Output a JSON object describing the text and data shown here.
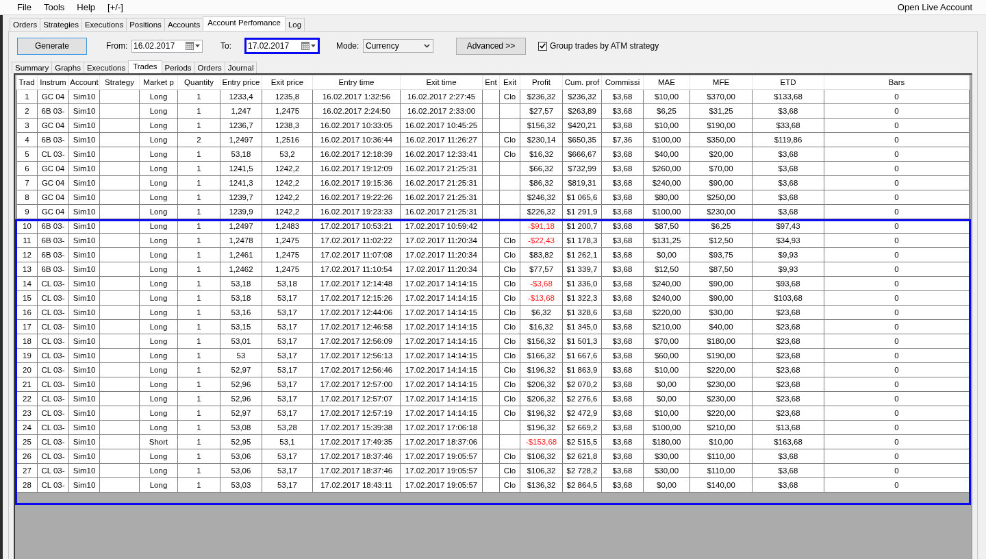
{
  "menu": {
    "items": [
      "File",
      "Tools",
      "Help",
      "[+/-]"
    ],
    "right_item": "Open Live Account"
  },
  "tabs": [
    {
      "label": "Orders",
      "selected": false
    },
    {
      "label": "Strategies",
      "selected": false
    },
    {
      "label": "Executions",
      "selected": false
    },
    {
      "label": "Positions",
      "selected": false
    },
    {
      "label": "Accounts",
      "selected": false
    },
    {
      "label": "Account Perfomance",
      "selected": true
    },
    {
      "label": "Log",
      "selected": false
    }
  ],
  "toolbar": {
    "generate_button": {
      "label": "Generate",
      "focused": true
    },
    "from": {
      "label": "From:",
      "value": "16.02.2017",
      "highlighted": false
    },
    "to": {
      "label": "To:",
      "value": "17.02.2017",
      "highlighted": true
    },
    "mode": {
      "label": "Mode:",
      "value": "Currency"
    },
    "advanced_button": "Advanced >>",
    "group_trades": {
      "label": "Group trades by ATM strategy",
      "checked": true
    }
  },
  "subtabs": [
    {
      "label": "Summary",
      "selected": false
    },
    {
      "label": "Graphs",
      "selected": false
    },
    {
      "label": "Executions",
      "selected": false
    },
    {
      "label": "Trades",
      "selected": true
    },
    {
      "label": "Periods",
      "selected": false
    },
    {
      "label": "Orders",
      "selected": false
    },
    {
      "label": "Journal",
      "selected": false
    }
  ],
  "table": {
    "columns": [
      "Trad",
      "Instrum",
      "Account",
      "Strategy",
      "Market p",
      "Quantity",
      "Entry price",
      "Exit price",
      "Entry time",
      "Exit time",
      "Ent",
      "Exit",
      "Profit",
      "Cum. prof",
      "Commissi",
      "MAE",
      "MFE",
      "ETD",
      "Bars"
    ],
    "row_groups": [
      {
        "highlighted": false,
        "rows": [
          {
            "trade": "1",
            "instrument": "GC 04",
            "account": "Sim10",
            "position": "Long",
            "quantity": "1",
            "entry_price": "1233,4",
            "exit_price": "1235,8",
            "entry_time": "16.02.2017 1:32:56",
            "exit_time": "16.02.2017 2:27:45",
            "exit": "Clo",
            "profit": "$236,32",
            "cum_profit": "$236,32",
            "commission": "$3,68",
            "mae": "$10,00",
            "mfe": "$370,00",
            "etd": "$133,68",
            "bars": "0",
            "loss": false
          },
          {
            "trade": "2",
            "instrument": "6B 03-",
            "account": "Sim10",
            "position": "Long",
            "quantity": "1",
            "entry_price": "1,247",
            "exit_price": "1,2475",
            "entry_time": "16.02.2017 2:24:50",
            "exit_time": "16.02.2017 2:33:00",
            "profit": "$27,57",
            "cum_profit": "$263,89",
            "commission": "$3,68",
            "mae": "$6,25",
            "mfe": "$31,25",
            "etd": "$3,68",
            "bars": "0",
            "loss": false
          },
          {
            "trade": "3",
            "instrument": "GC 04",
            "account": "Sim10",
            "position": "Long",
            "quantity": "1",
            "entry_price": "1236,7",
            "exit_price": "1238,3",
            "entry_time": "16.02.2017 10:33:05",
            "exit_time": "16.02.2017 10:45:25",
            "profit": "$156,32",
            "cum_profit": "$420,21",
            "commission": "$3,68",
            "mae": "$10,00",
            "mfe": "$190,00",
            "etd": "$33,68",
            "bars": "0",
            "loss": false
          },
          {
            "trade": "4",
            "instrument": "6B 03-",
            "account": "Sim10",
            "position": "Long",
            "quantity": "2",
            "entry_price": "1,2497",
            "exit_price": "1,2516",
            "entry_time": "16.02.2017 10:36:44",
            "exit_time": "16.02.2017 11:26:27",
            "exit": "Clo",
            "profit": "$230,14",
            "cum_profit": "$650,35",
            "commission": "$7,36",
            "mae": "$100,00",
            "mfe": "$350,00",
            "etd": "$119,86",
            "bars": "0",
            "loss": false
          },
          {
            "trade": "5",
            "instrument": "CL 03-",
            "account": "Sim10",
            "position": "Long",
            "quantity": "1",
            "entry_price": "53,18",
            "exit_price": "53,2",
            "entry_time": "16.02.2017 12:18:39",
            "exit_time": "16.02.2017 12:33:41",
            "exit": "Clo",
            "profit": "$16,32",
            "cum_profit": "$666,67",
            "commission": "$3,68",
            "mae": "$40,00",
            "mfe": "$20,00",
            "etd": "$3,68",
            "bars": "0",
            "loss": false
          },
          {
            "trade": "6",
            "instrument": "GC 04",
            "account": "Sim10",
            "position": "Long",
            "quantity": "1",
            "entry_price": "1241,5",
            "exit_price": "1242,2",
            "entry_time": "16.02.2017 19:12:09",
            "exit_time": "16.02.2017 21:25:31",
            "profit": "$66,32",
            "cum_profit": "$732,99",
            "commission": "$3,68",
            "mae": "$260,00",
            "mfe": "$70,00",
            "etd": "$3,68",
            "bars": "0",
            "loss": false
          },
          {
            "trade": "7",
            "instrument": "GC 04",
            "account": "Sim10",
            "position": "Long",
            "quantity": "1",
            "entry_price": "1241,3",
            "exit_price": "1242,2",
            "entry_time": "16.02.2017 19:15:36",
            "exit_time": "16.02.2017 21:25:31",
            "profit": "$86,32",
            "cum_profit": "$819,31",
            "commission": "$3,68",
            "mae": "$240,00",
            "mfe": "$90,00",
            "etd": "$3,68",
            "bars": "0",
            "loss": false
          },
          {
            "trade": "8",
            "instrument": "GC 04",
            "account": "Sim10",
            "position": "Long",
            "quantity": "1",
            "entry_price": "1239,7",
            "exit_price": "1242,2",
            "entry_time": "16.02.2017 19:22:26",
            "exit_time": "16.02.2017 21:25:31",
            "profit": "$246,32",
            "cum_profit": "$1 065,6",
            "commission": "$3,68",
            "mae": "$80,00",
            "mfe": "$250,00",
            "etd": "$3,68",
            "bars": "0",
            "loss": false
          },
          {
            "trade": "9",
            "instrument": "GC 04",
            "account": "Sim10",
            "position": "Long",
            "quantity": "1",
            "entry_price": "1239,9",
            "exit_price": "1242,2",
            "entry_time": "16.02.2017 19:23:33",
            "exit_time": "16.02.2017 21:25:31",
            "profit": "$226,32",
            "cum_profit": "$1 291,9",
            "commission": "$3,68",
            "mae": "$100,00",
            "mfe": "$230,00",
            "etd": "$3,68",
            "bars": "0",
            "loss": false
          }
        ]
      },
      {
        "highlighted": true,
        "rows": [
          {
            "trade": "10",
            "instrument": "6B 03-",
            "account": "Sim10",
            "position": "Long",
            "quantity": "1",
            "entry_price": "1,2497",
            "exit_price": "1,2483",
            "entry_time": "17.02.2017 10:53:21",
            "exit_time": "17.02.2017 10:59:42",
            "profit": "-$91,18",
            "cum_profit": "$1 200,7",
            "commission": "$3,68",
            "mae": "$87,50",
            "mfe": "$6,25",
            "etd": "$97,43",
            "bars": "0",
            "loss": true
          },
          {
            "trade": "11",
            "instrument": "6B 03-",
            "account": "Sim10",
            "position": "Long",
            "quantity": "1",
            "entry_price": "1,2478",
            "exit_price": "1,2475",
            "entry_time": "17.02.2017 11:02:22",
            "exit_time": "17.02.2017 11:20:34",
            "exit": "Clo",
            "profit": "-$22,43",
            "cum_profit": "$1 178,3",
            "commission": "$3,68",
            "mae": "$131,25",
            "mfe": "$12,50",
            "etd": "$34,93",
            "bars": "0",
            "loss": true
          },
          {
            "trade": "12",
            "instrument": "6B 03-",
            "account": "Sim10",
            "position": "Long",
            "quantity": "1",
            "entry_price": "1,2461",
            "exit_price": "1,2475",
            "entry_time": "17.02.2017 11:07:08",
            "exit_time": "17.02.2017 11:20:34",
            "exit": "Clo",
            "profit": "$83,82",
            "cum_profit": "$1 262,1",
            "commission": "$3,68",
            "mae": "$0,00",
            "mfe": "$93,75",
            "etd": "$9,93",
            "bars": "0",
            "loss": false
          },
          {
            "trade": "13",
            "instrument": "6B 03-",
            "account": "Sim10",
            "position": "Long",
            "quantity": "1",
            "entry_price": "1,2462",
            "exit_price": "1,2475",
            "entry_time": "17.02.2017 11:10:54",
            "exit_time": "17.02.2017 11:20:34",
            "exit": "Clo",
            "profit": "$77,57",
            "cum_profit": "$1 339,7",
            "commission": "$3,68",
            "mae": "$12,50",
            "mfe": "$87,50",
            "etd": "$9,93",
            "bars": "0",
            "loss": false
          },
          {
            "trade": "14",
            "instrument": "CL 03-",
            "account": "Sim10",
            "position": "Long",
            "quantity": "1",
            "entry_price": "53,18",
            "exit_price": "53,18",
            "entry_time": "17.02.2017 12:14:48",
            "exit_time": "17.02.2017 14:14:15",
            "exit": "Clo",
            "profit": "-$3,68",
            "cum_profit": "$1 336,0",
            "commission": "$3,68",
            "mae": "$240,00",
            "mfe": "$90,00",
            "etd": "$93,68",
            "bars": "0",
            "loss": true
          },
          {
            "trade": "15",
            "instrument": "CL 03-",
            "account": "Sim10",
            "position": "Long",
            "quantity": "1",
            "entry_price": "53,18",
            "exit_price": "53,17",
            "entry_time": "17.02.2017 12:15:26",
            "exit_time": "17.02.2017 14:14:15",
            "exit": "Clo",
            "profit": "-$13,68",
            "cum_profit": "$1 322,3",
            "commission": "$3,68",
            "mae": "$240,00",
            "mfe": "$90,00",
            "etd": "$103,68",
            "bars": "0",
            "loss": true
          },
          {
            "trade": "16",
            "instrument": "CL 03-",
            "account": "Sim10",
            "position": "Long",
            "quantity": "1",
            "entry_price": "53,16",
            "exit_price": "53,17",
            "entry_time": "17.02.2017 12:44:06",
            "exit_time": "17.02.2017 14:14:15",
            "exit": "Clo",
            "profit": "$6,32",
            "cum_profit": "$1 328,6",
            "commission": "$3,68",
            "mae": "$220,00",
            "mfe": "$30,00",
            "etd": "$23,68",
            "bars": "0",
            "loss": false
          },
          {
            "trade": "17",
            "instrument": "CL 03-",
            "account": "Sim10",
            "position": "Long",
            "quantity": "1",
            "entry_price": "53,15",
            "exit_price": "53,17",
            "entry_time": "17.02.2017 12:46:58",
            "exit_time": "17.02.2017 14:14:15",
            "exit": "Clo",
            "profit": "$16,32",
            "cum_profit": "$1 345,0",
            "commission": "$3,68",
            "mae": "$210,00",
            "mfe": "$40,00",
            "etd": "$23,68",
            "bars": "0",
            "loss": false
          },
          {
            "trade": "18",
            "instrument": "CL 03-",
            "account": "Sim10",
            "position": "Long",
            "quantity": "1",
            "entry_price": "53,01",
            "exit_price": "53,17",
            "entry_time": "17.02.2017 12:56:09",
            "exit_time": "17.02.2017 14:14:15",
            "exit": "Clo",
            "profit": "$156,32",
            "cum_profit": "$1 501,3",
            "commission": "$3,68",
            "mae": "$70,00",
            "mfe": "$180,00",
            "etd": "$23,68",
            "bars": "0",
            "loss": false
          },
          {
            "trade": "19",
            "instrument": "CL 03-",
            "account": "Sim10",
            "position": "Long",
            "quantity": "1",
            "entry_price": "53",
            "exit_price": "53,17",
            "entry_time": "17.02.2017 12:56:13",
            "exit_time": "17.02.2017 14:14:15",
            "exit": "Clo",
            "profit": "$166,32",
            "cum_profit": "$1 667,6",
            "commission": "$3,68",
            "mae": "$60,00",
            "mfe": "$190,00",
            "etd": "$23,68",
            "bars": "0",
            "loss": false
          },
          {
            "trade": "20",
            "instrument": "CL 03-",
            "account": "Sim10",
            "position": "Long",
            "quantity": "1",
            "entry_price": "52,97",
            "exit_price": "53,17",
            "entry_time": "17.02.2017 12:56:46",
            "exit_time": "17.02.2017 14:14:15",
            "exit": "Clo",
            "profit": "$196,32",
            "cum_profit": "$1 863,9",
            "commission": "$3,68",
            "mae": "$10,00",
            "mfe": "$220,00",
            "etd": "$23,68",
            "bars": "0",
            "loss": false
          },
          {
            "trade": "21",
            "instrument": "CL 03-",
            "account": "Sim10",
            "position": "Long",
            "quantity": "1",
            "entry_price": "52,96",
            "exit_price": "53,17",
            "entry_time": "17.02.2017 12:57:00",
            "exit_time": "17.02.2017 14:14:15",
            "exit": "Clo",
            "profit": "$206,32",
            "cum_profit": "$2 070,2",
            "commission": "$3,68",
            "mae": "$0,00",
            "mfe": "$230,00",
            "etd": "$23,68",
            "bars": "0",
            "loss": false
          },
          {
            "trade": "22",
            "instrument": "CL 03-",
            "account": "Sim10",
            "position": "Long",
            "quantity": "1",
            "entry_price": "52,96",
            "exit_price": "53,17",
            "entry_time": "17.02.2017 12:57:07",
            "exit_time": "17.02.2017 14:14:15",
            "exit": "Clo",
            "profit": "$206,32",
            "cum_profit": "$2 276,6",
            "commission": "$3,68",
            "mae": "$0,00",
            "mfe": "$230,00",
            "etd": "$23,68",
            "bars": "0",
            "loss": false
          },
          {
            "trade": "23",
            "instrument": "CL 03-",
            "account": "Sim10",
            "position": "Long",
            "quantity": "1",
            "entry_price": "52,97",
            "exit_price": "53,17",
            "entry_time": "17.02.2017 12:57:19",
            "exit_time": "17.02.2017 14:14:15",
            "exit": "Clo",
            "profit": "$196,32",
            "cum_profit": "$2 472,9",
            "commission": "$3,68",
            "mae": "$10,00",
            "mfe": "$220,00",
            "etd": "$23,68",
            "bars": "0",
            "loss": false
          },
          {
            "trade": "24",
            "instrument": "CL 03-",
            "account": "Sim10",
            "position": "Long",
            "quantity": "1",
            "entry_price": "53,08",
            "exit_price": "53,28",
            "entry_time": "17.02.2017 15:39:38",
            "exit_time": "17.02.2017 17:06:18",
            "profit": "$196,32",
            "cum_profit": "$2 669,2",
            "commission": "$3,68",
            "mae": "$100,00",
            "mfe": "$210,00",
            "etd": "$13,68",
            "bars": "0",
            "loss": false
          },
          {
            "trade": "25",
            "instrument": "CL 03-",
            "account": "Sim10",
            "position": "Short",
            "quantity": "1",
            "entry_price": "52,95",
            "exit_price": "53,1",
            "entry_time": "17.02.2017 17:49:35",
            "exit_time": "17.02.2017 18:37:06",
            "profit": "-$153,68",
            "cum_profit": "$2 515,5",
            "commission": "$3,68",
            "mae": "$180,00",
            "mfe": "$10,00",
            "etd": "$163,68",
            "bars": "0",
            "loss": true
          },
          {
            "trade": "26",
            "instrument": "CL 03-",
            "account": "Sim10",
            "position": "Long",
            "quantity": "1",
            "entry_price": "53,06",
            "exit_price": "53,17",
            "entry_time": "17.02.2017 18:37:46",
            "exit_time": "17.02.2017 19:05:57",
            "exit": "Clo",
            "profit": "$106,32",
            "cum_profit": "$2 621,8",
            "commission": "$3,68",
            "mae": "$30,00",
            "mfe": "$110,00",
            "etd": "$3,68",
            "bars": "0",
            "loss": false
          },
          {
            "trade": "27",
            "instrument": "CL 03-",
            "account": "Sim10",
            "position": "Long",
            "quantity": "1",
            "entry_price": "53,06",
            "exit_price": "53,17",
            "entry_time": "17.02.2017 18:37:46",
            "exit_time": "17.02.2017 19:05:57",
            "exit": "Clo",
            "profit": "$106,32",
            "cum_profit": "$2 728,2",
            "commission": "$3,68",
            "mae": "$30,00",
            "mfe": "$110,00",
            "etd": "$3,68",
            "bars": "0",
            "loss": false
          },
          {
            "trade": "28",
            "instrument": "CL 03-",
            "account": "Sim10",
            "position": "Long",
            "quantity": "1",
            "entry_price": "53,03",
            "exit_price": "53,17",
            "entry_time": "17.02.2017 18:43:11",
            "exit_time": "17.02.2017 19:05:57",
            "exit": "Clo",
            "profit": "$136,32",
            "cum_profit": "$2 864,5",
            "commission": "$3,68",
            "mae": "$0,00",
            "mfe": "$140,00",
            "etd": "$3,68",
            "bars": "0",
            "loss": false
          }
        ]
      }
    ]
  }
}
